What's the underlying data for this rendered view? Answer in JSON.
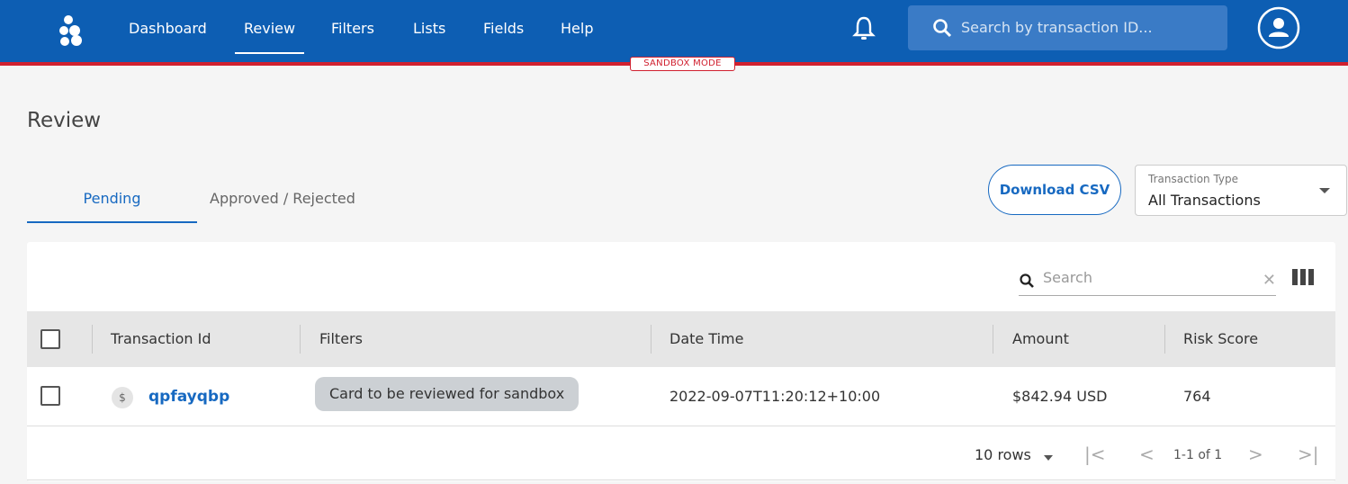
{
  "header": {
    "nav": [
      {
        "label": "Dashboard"
      },
      {
        "label": "Review"
      },
      {
        "label": "Filters"
      },
      {
        "label": "Lists"
      },
      {
        "label": "Fields"
      },
      {
        "label": "Help"
      }
    ],
    "active_nav": "Review",
    "search_placeholder": "Search by transaction ID...",
    "sandbox_label": "SANDBOX MODE",
    "icons": [
      "logo-icon",
      "bell-icon",
      "search-icon",
      "account-icon"
    ],
    "colors": {
      "primary": "#0d5eb3",
      "sandbox_accent": "#d0202f",
      "link": "#1769c1"
    }
  },
  "page": {
    "title": "Review",
    "tabs": [
      {
        "label": "Pending",
        "active": true
      },
      {
        "label": "Approved / Rejected",
        "active": false
      }
    ],
    "download_label": "Download CSV",
    "transaction_type": {
      "label": "Transaction Type",
      "value": "All Transactions"
    }
  },
  "table": {
    "search_placeholder": "Search",
    "columns": [
      "Transaction Id",
      "Filters",
      "Date Time",
      "Amount",
      "Risk Score"
    ],
    "rows": [
      {
        "currency_icon": "$",
        "transaction_id": "qpfayqbp",
        "filter": "Card to be reviewed for sandbox",
        "date_time": "2022-09-07T11:20:12+10:00",
        "amount": "$842.94 USD",
        "risk_score": "764"
      }
    ],
    "pagination": {
      "rows_per_page": "10 rows",
      "range": "1-1 of 1"
    }
  }
}
